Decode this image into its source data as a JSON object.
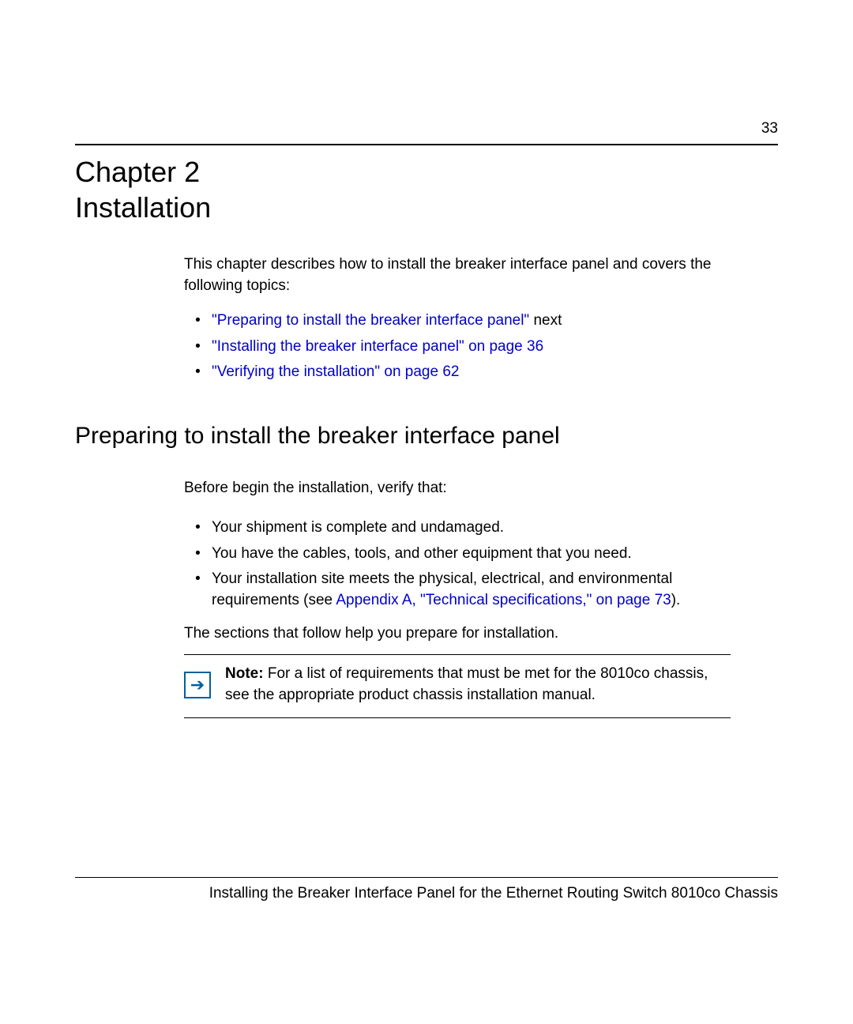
{
  "page_number": "33",
  "chapter": {
    "label": "Chapter 2",
    "title": "Installation"
  },
  "intro": "This chapter describes how to install the breaker interface panel and covers the following topics:",
  "topics": [
    {
      "link": "\"Preparing to install the breaker interface panel\"",
      "suffix": " next"
    },
    {
      "link": "\"Installing the breaker interface panel\" on page 36",
      "suffix": ""
    },
    {
      "link": "\"Verifying the installation\" on page 62",
      "suffix": ""
    }
  ],
  "section_heading": "Preparing to install the breaker interface panel",
  "section_intro": "Before begin the installation, verify that:",
  "checks": {
    "item1": "Your shipment is complete and undamaged.",
    "item2": "You have the cables, tools, and other equipment that you need.",
    "item3_pre": "Your installation site meets the physical, electrical, and environmental requirements (see ",
    "item3_link": "Appendix A, \"Technical specifications,\" on page 73",
    "item3_post": ")."
  },
  "post_list": "The sections that follow help you prepare for installation.",
  "note": {
    "label": "Note:",
    "text": " For a list of requirements that must be met for the 8010co chassis, see the appropriate product chassis installation manual."
  },
  "footer": "Installing the Breaker Interface Panel for the Ethernet Routing Switch 8010co Chassis"
}
